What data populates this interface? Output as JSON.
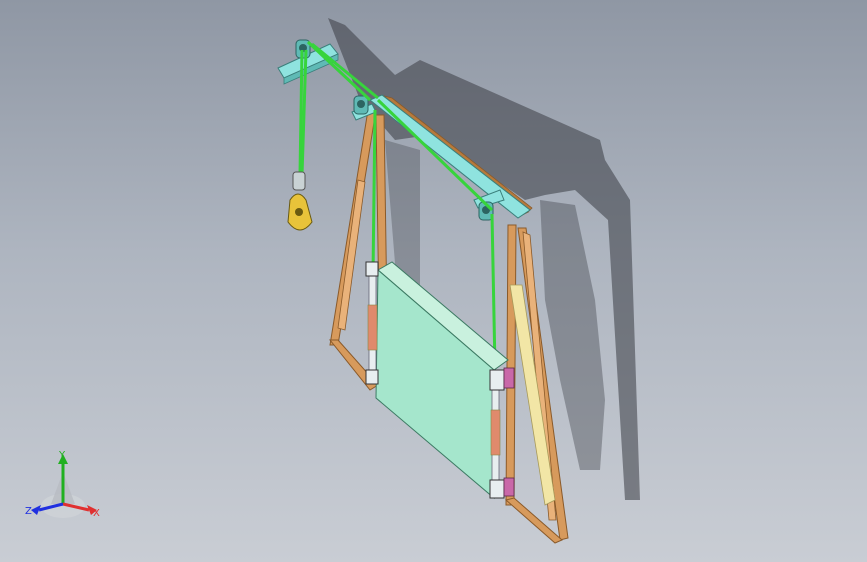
{
  "viewport": {
    "background_top": "#8f97a4",
    "background_bottom": "#c9cdd4"
  },
  "colors": {
    "rope": "#37d43c",
    "rail": "#8fe3df",
    "wood": "#d79a5c",
    "wood_dark": "#8a5a2a",
    "gate": "#a5e6cc",
    "gate_side": "#c9f1de",
    "pulley_block": "#e8c33a",
    "brace": "#f2e6a6",
    "bracket": "#c968a8",
    "axis_x": "#e03030",
    "axis_y": "#20b020",
    "axis_z": "#2030e0"
  },
  "triad": {
    "x_label": "X",
    "y_label": "Y",
    "z_label": "Z"
  }
}
